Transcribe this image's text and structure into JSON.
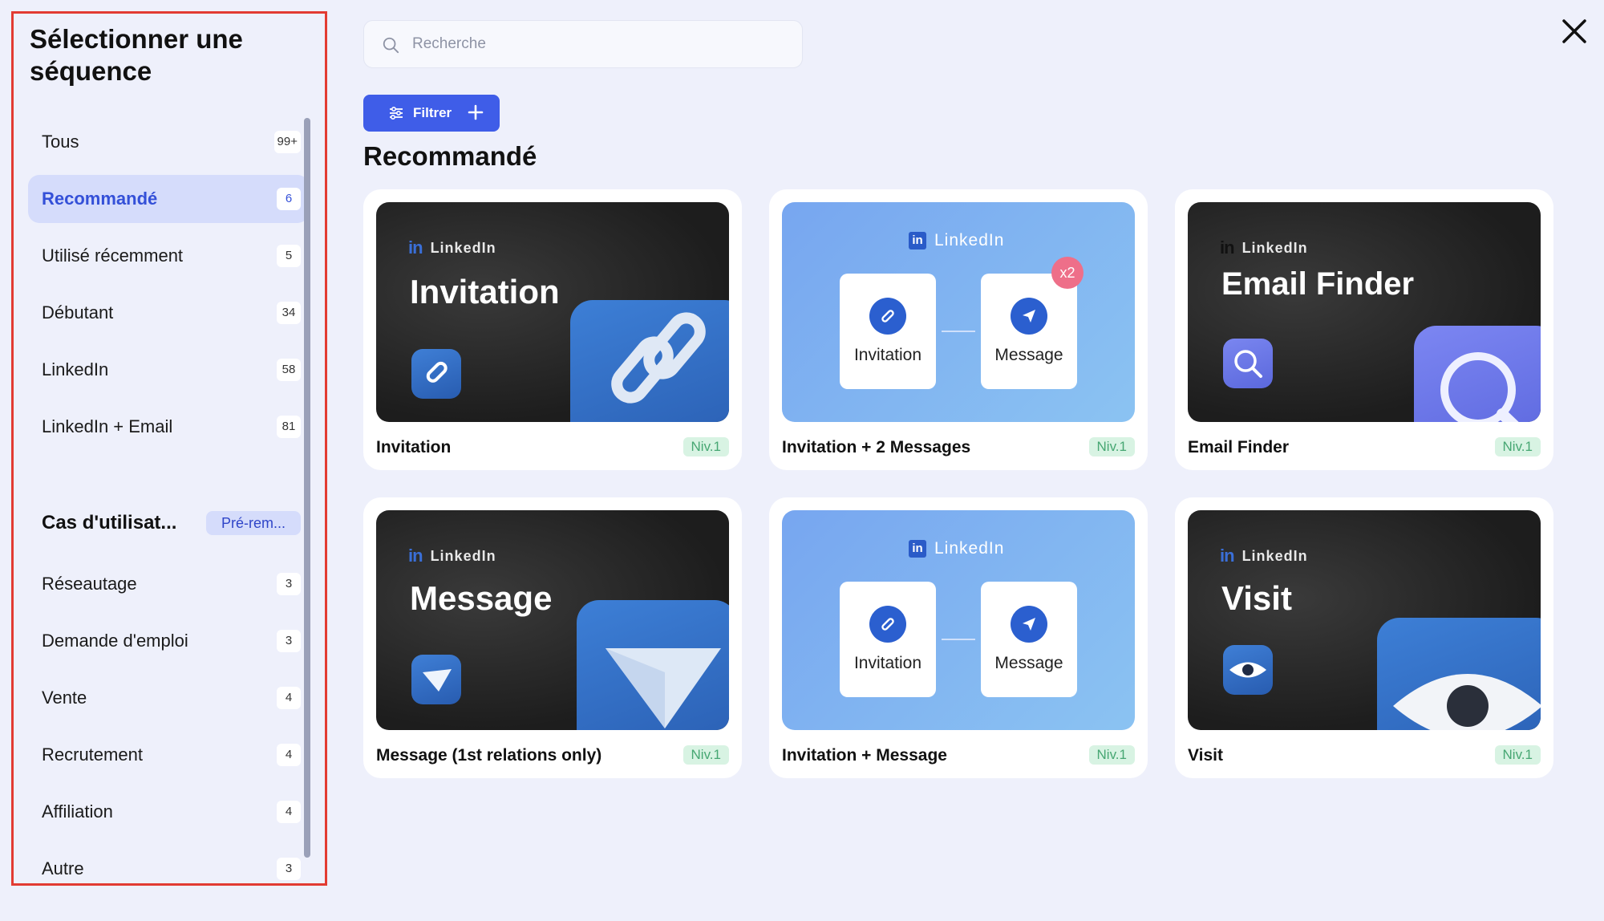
{
  "sidebar": {
    "title": "Sélectionner une séquence",
    "items": [
      {
        "label": "Tous",
        "count": "99+"
      },
      {
        "label": "Recommandé",
        "count": "6"
      },
      {
        "label": "Utilisé récemment",
        "count": "5"
      },
      {
        "label": "Débutant",
        "count": "34"
      },
      {
        "label": "LinkedIn",
        "count": "58"
      },
      {
        "label": "LinkedIn + Email",
        "count": "81"
      }
    ],
    "active_item": "Recommandé",
    "section": {
      "label": "Cas d'utilisat...",
      "badge": "Pré-rem..."
    },
    "use_cases": [
      {
        "label": "Réseautage",
        "count": "3"
      },
      {
        "label": "Demande d'emploi",
        "count": "3"
      },
      {
        "label": "Vente",
        "count": "4"
      },
      {
        "label": "Recrutement",
        "count": "4"
      },
      {
        "label": "Affiliation",
        "count": "4"
      },
      {
        "label": "Autre",
        "count": "3"
      }
    ]
  },
  "search": {
    "placeholder": "Recherche",
    "value": ""
  },
  "filter": {
    "label": "Filtrer"
  },
  "section_title": "Recommandé",
  "linkedin_label": "LinkedIn",
  "cards": [
    {
      "title": "Invitation",
      "level": "Niv.1",
      "thumb_title": "Invitation"
    },
    {
      "title": "Invitation + 2 Messages",
      "level": "Niv.1",
      "steps": [
        "Invitation",
        "Message"
      ],
      "multiplier": "x2"
    },
    {
      "title": "Email Finder",
      "level": "Niv.1",
      "thumb_title": "Email Finder"
    },
    {
      "title": "Message (1st relations only)",
      "level": "Niv.1",
      "thumb_title": "Message"
    },
    {
      "title": "Invitation + Message",
      "level": "Niv.1",
      "steps": [
        "Invitation",
        "Message"
      ]
    },
    {
      "title": "Visit",
      "level": "Niv.1",
      "thumb_title": "Visit"
    }
  ],
  "icons": {
    "search": "search-icon",
    "close": "close-icon",
    "filter": "sliders-icon",
    "plus": "plus-icon",
    "link": "link-icon",
    "send": "send-icon",
    "magnifier": "magnifier-icon",
    "paper_plane": "paper-plane-icon",
    "eye": "eye-icon"
  },
  "colors": {
    "accent": "#3f5de8",
    "active_bg": "#d5dcfb",
    "level_bg": "#d8f3e3",
    "level_text": "#47a773",
    "highlight_border": "#e23b32"
  }
}
